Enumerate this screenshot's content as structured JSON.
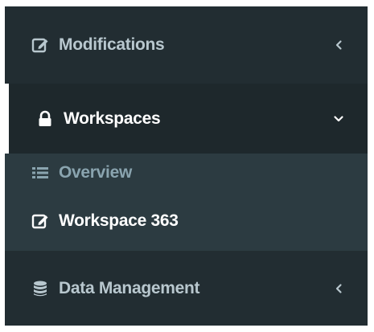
{
  "sidebar": {
    "items": [
      {
        "label": "Modifications",
        "icon": "edit-icon",
        "state": "collapsed",
        "chevron": "chevron-left-icon"
      },
      {
        "label": "Workspaces",
        "icon": "lock-icon",
        "state": "expanded",
        "chevron": "chevron-down-icon",
        "children": [
          {
            "label": "Overview",
            "icon": "list-icon"
          },
          {
            "label": "Workspace 363",
            "icon": "edit-icon"
          }
        ]
      },
      {
        "label": "Data Management",
        "icon": "database-icon",
        "state": "collapsed",
        "chevron": "chevron-left-icon"
      }
    ]
  },
  "colors": {
    "sidebar_bg": "#222d32",
    "active_bg": "#1e282c",
    "submenu_bg": "#2c3b41",
    "active_border": "#ffffff",
    "text_muted": "#b8c7ce",
    "text_submenu_muted": "#8aa4af",
    "text_active": "#ffffff"
  }
}
